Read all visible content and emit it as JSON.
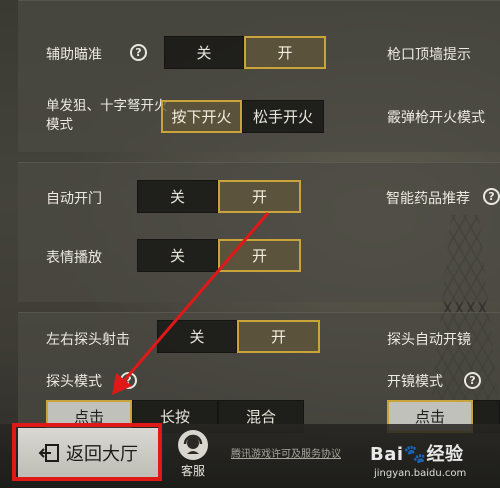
{
  "settings": {
    "aim_assist": {
      "label": "辅助瞄准",
      "options": [
        "关",
        "开"
      ],
      "selected": "开"
    },
    "muzzle_tip": {
      "label": "枪口顶墙提示"
    },
    "sniper_fire_mode": {
      "label": "单发狙、十字弩开火模式",
      "options": [
        "按下开火",
        "松手开火"
      ],
      "selected": "按下开火"
    },
    "shotgun_fire_mode": {
      "label": "霰弹枪开火模式"
    },
    "auto_door": {
      "label": "自动开门",
      "options": [
        "关",
        "开"
      ],
      "selected": "开"
    },
    "smart_meds": {
      "label": "智能药品推荐"
    },
    "emote_play": {
      "label": "表情播放",
      "options": [
        "关",
        "开"
      ],
      "selected": "开"
    },
    "peek_fire": {
      "label": "左右探头射击",
      "options": [
        "关",
        "开"
      ],
      "selected": "开"
    },
    "peek_auto_scope": {
      "label": "探头自动开镜"
    },
    "peek_mode": {
      "label": "探头模式",
      "options": [
        "点击",
        "长按",
        "混合"
      ],
      "selected": "点击"
    },
    "scope_mode": {
      "label": "开镜模式",
      "options": [
        "点击"
      ],
      "selected": "点击"
    }
  },
  "help_glyph": "?",
  "footer": {
    "back_label": "返回大厅",
    "support_label": "客服",
    "license_link": "腾讯游戏许可及服务协议"
  },
  "watermark": {
    "logo": "Bai🐾经验",
    "url": "jingyan.baidu.com"
  },
  "colors": {
    "accent": "#c9a43a",
    "annotation": "#e01818"
  }
}
